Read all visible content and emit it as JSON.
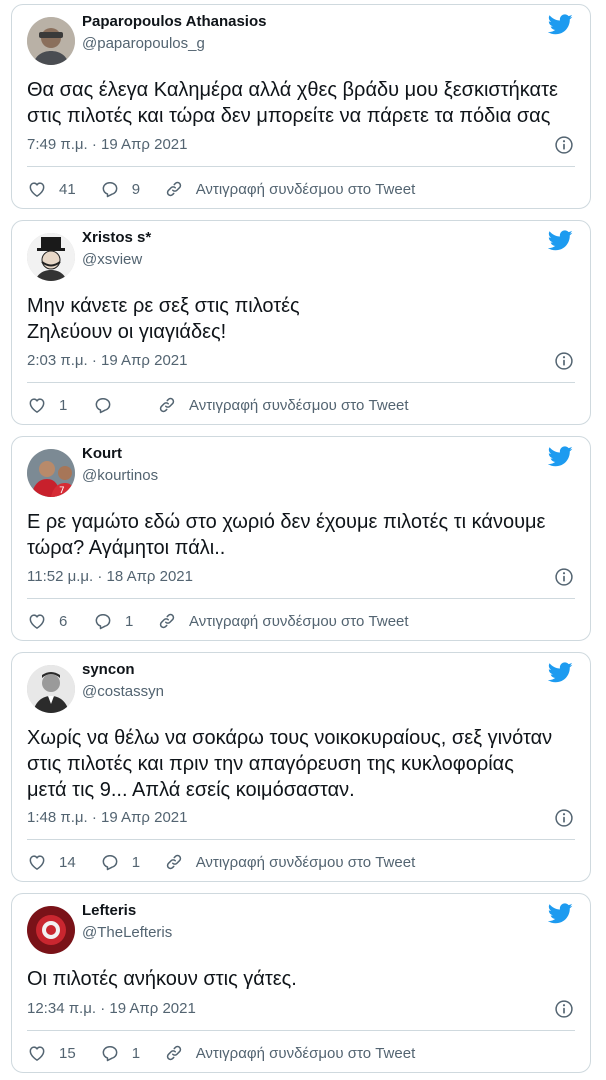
{
  "colors": {
    "accent": "#1d9bf0",
    "muted": "#536471",
    "text": "#0f1419",
    "border": "#cfd9de"
  },
  "icons": {
    "brand": "twitter-bird-icon",
    "info": "info-icon",
    "like": "heart-icon",
    "reply": "reply-bubble-icon",
    "link": "link-icon"
  },
  "tweets": [
    {
      "name": "Paparopoulos Athanasios",
      "handle": "@paparopoulos_g",
      "text": "Θα σας έλεγα Καλημέρα αλλά χθες βράδυ μου ξεσκιστήκατε\nστις πιλοτές και τώρα δεν μπορείτε να πάρετε τα πόδια σας",
      "timestamp": "7:49 π.μ. · 19 Απρ 2021",
      "likes": "41",
      "replies": "9",
      "copy_link": "Αντιγραφή συνδέσμου στο Tweet"
    },
    {
      "name": "Xristos s*",
      "handle": "@xsview",
      "text": "Μην κάνετε ρε σεξ στις πιλοτές\nΖηλεύουν οι γιαγιάδες!",
      "timestamp": "2:03 π.μ. · 19 Απρ 2021",
      "likes": "1",
      "replies": "",
      "copy_link": "Αντιγραφή συνδέσμου στο Tweet"
    },
    {
      "name": "Kourt",
      "handle": "@kourtinos",
      "text": "Ε ρε γαμώτο εδώ στο χωριό δεν έχουμε πιλοτές τι κάνουμε\nτώρα? Αγάμητοι πάλι..",
      "timestamp": "11:52 μ.μ. · 18 Απρ 2021",
      "likes": "6",
      "replies": "1",
      "copy_link": "Αντιγραφή συνδέσμου στο Tweet"
    },
    {
      "name": "syncon",
      "handle": "@costassyn",
      "text": "Χωρίς να θέλω να σοκάρω τους νοικοκυραίους,  σεξ γινόταν\nστις πιλοτές και πριν την απαγόρευση της κυκλοφορίας\nμετά τις 9... Απλά εσείς κοιμόσασταν.",
      "timestamp": "1:48 π.μ. · 19 Απρ 2021",
      "likes": "14",
      "replies": "1",
      "copy_link": "Αντιγραφή συνδέσμου στο Tweet"
    },
    {
      "name": "Lefteris",
      "handle": "@TheLefteris",
      "text": "Οι πιλοτές ανήκουν στις γάτες.",
      "timestamp": "12:34 π.μ. · 19 Απρ 2021",
      "likes": "15",
      "replies": "1",
      "copy_link": "Αντιγραφή συνδέσμου στο Tweet"
    }
  ]
}
